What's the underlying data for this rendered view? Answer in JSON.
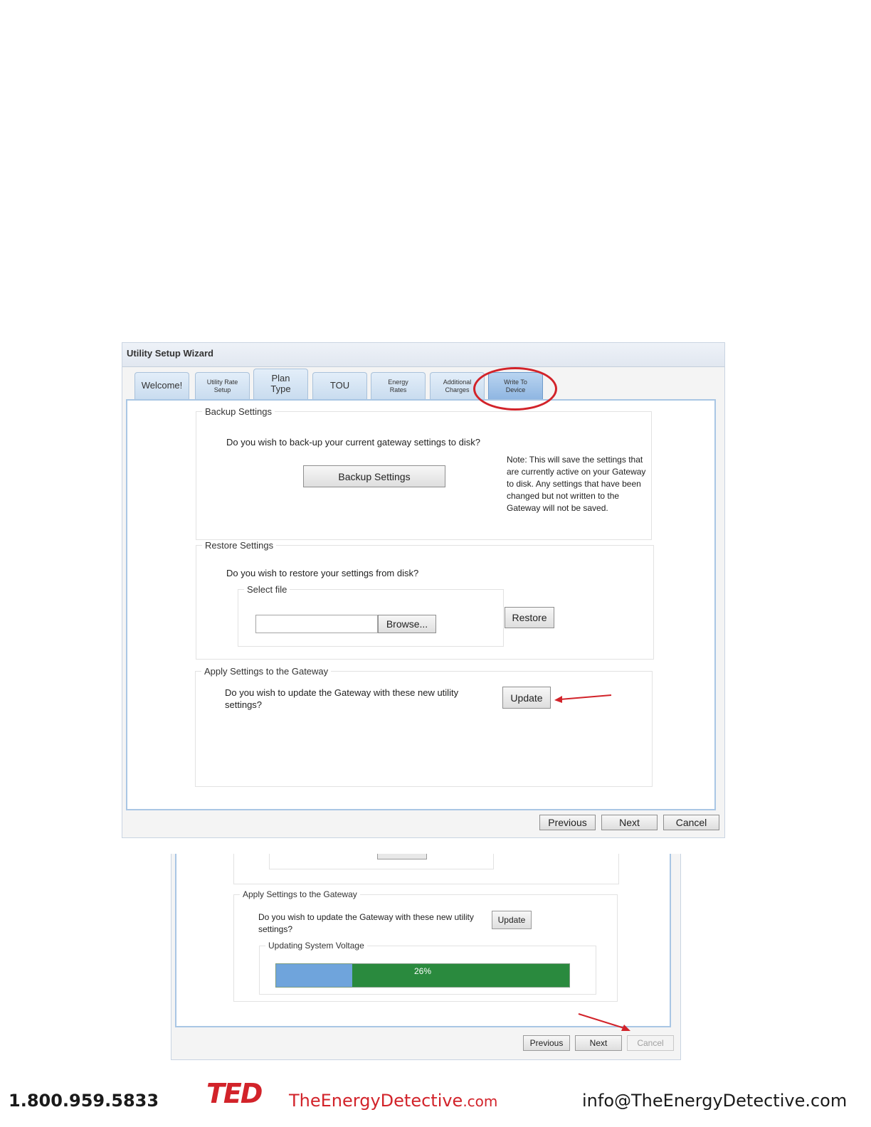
{
  "window": {
    "title": "Utility Setup Wizard"
  },
  "tabs": [
    {
      "label": "Welcome!"
    },
    {
      "label": "Utility Rate\nSetup"
    },
    {
      "label": "Plan\nType"
    },
    {
      "label": "TOU"
    },
    {
      "label": "Energy\nRates"
    },
    {
      "label": "Additional\nCharges"
    },
    {
      "label": "Write To\nDevice",
      "active": true
    }
  ],
  "backup": {
    "legend": "Backup Settings",
    "question": "Do you wish to back-up your current gateway settings to disk?",
    "button": "Backup Settings",
    "note": "Note: This will save the settings that are currently active on your Gateway to disk. Any settings that have been changed but not written to the Gateway will not be saved."
  },
  "restore": {
    "legend": "Restore Settings",
    "question": "Do you wish to restore your settings from disk?",
    "select_legend": "Select file",
    "file_value": "",
    "browse_button": "Browse...",
    "restore_button": "Restore"
  },
  "apply": {
    "legend": "Apply Settings to the Gateway",
    "question": "Do you wish to update the Gateway with these new utility settings?",
    "update_button": "Update"
  },
  "nav": {
    "previous": "Previous",
    "next": "Next",
    "cancel": "Cancel"
  },
  "progress_view": {
    "apply_legend": "Apply Settings to the Gateway",
    "question": "Do you wish to update the Gateway with these new utility settings?",
    "update_button": "Update",
    "progress_legend": "Updating System Voltage",
    "progress_text": "26%",
    "progress_fraction": 0.26,
    "nav": {
      "previous": "Previous",
      "next": "Next",
      "cancel": "Cancel"
    }
  },
  "footer": {
    "phone": "1.800.959.5833",
    "logo": "TED",
    "site_name": "TheEnergyDetective",
    "site_tld": ".com",
    "email": "info@TheEnergyDetective.com"
  },
  "colors": {
    "highlight": "#d2232a",
    "progress_done": "#6fa4dc",
    "progress_track": "#2a8a3e"
  }
}
